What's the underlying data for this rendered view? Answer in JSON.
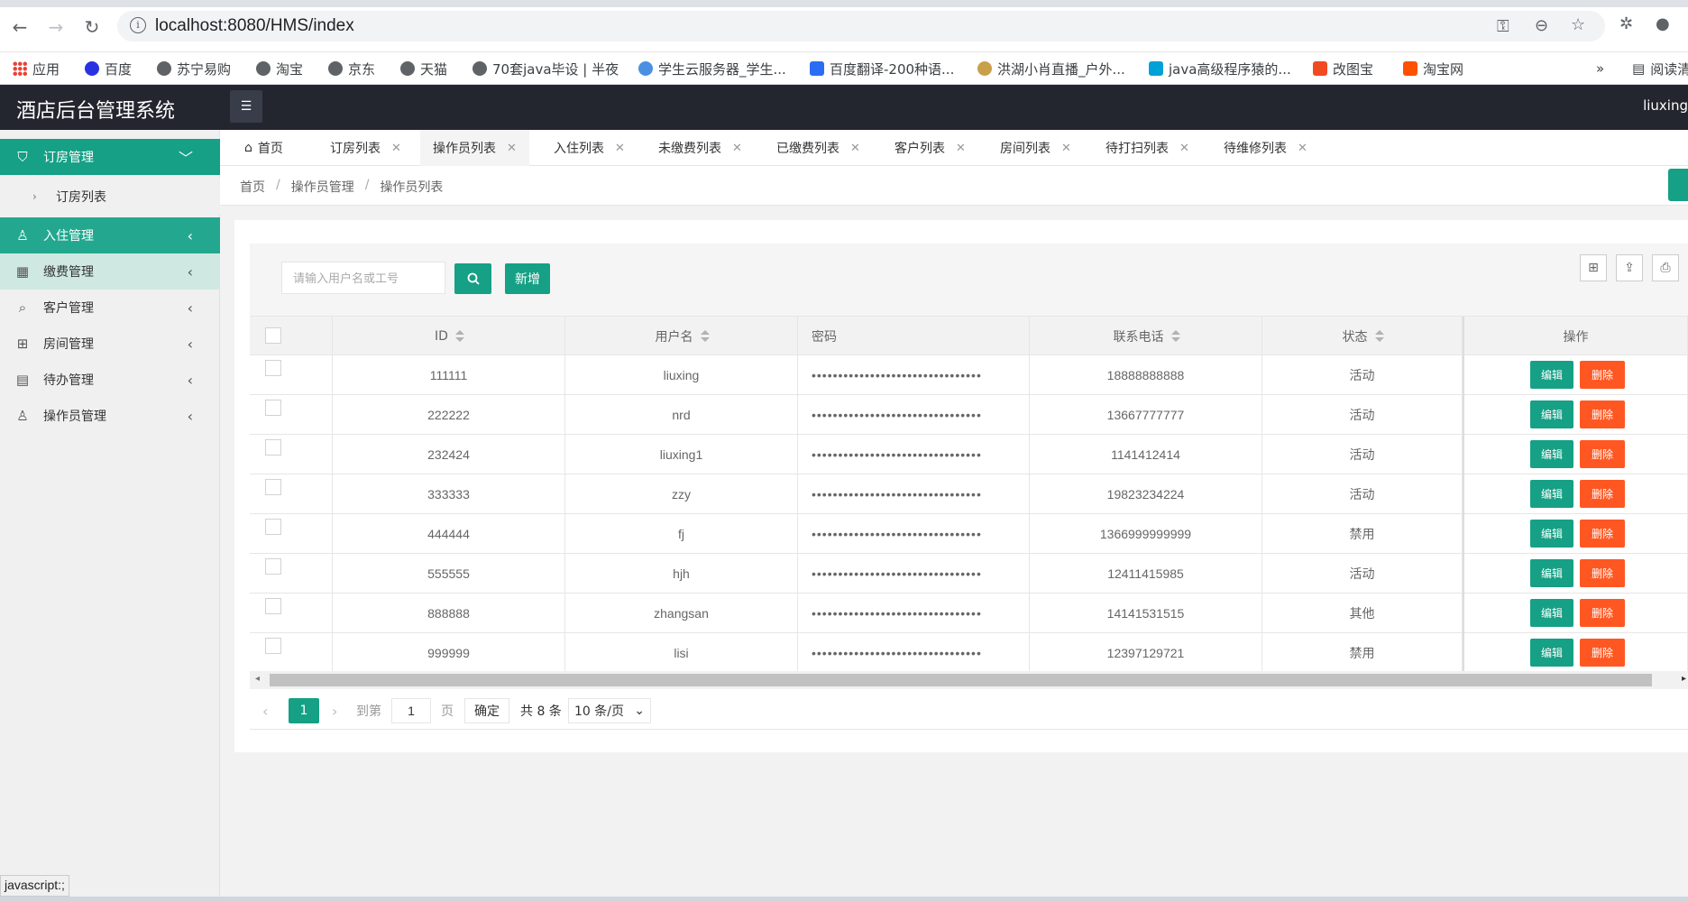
{
  "browser": {
    "url": "localhost:8080/HMS/index",
    "bookmarks": [
      "应用",
      "百度",
      "苏宁易购",
      "淘宝",
      "京东",
      "天猫",
      "70套java毕设 | 半夜",
      "学生云服务器_学生...",
      "百度翻译-200种语...",
      "洪湖小肖直播_户外...",
      "java高级程序猿的...",
      "改图宝",
      "淘宝网"
    ],
    "more_bookmarks": "»",
    "reading_list": "阅读清单"
  },
  "app": {
    "title": "酒店后台管理系统",
    "user": "liuxing"
  },
  "sidebar": {
    "items": [
      {
        "label": "订房管理",
        "icon": "shield-check-icon"
      },
      {
        "label": "入住管理",
        "icon": "user-icon"
      },
      {
        "label": "缴费管理",
        "icon": "bill-icon"
      },
      {
        "label": "客户管理",
        "icon": "search-icon"
      },
      {
        "label": "房间管理",
        "icon": "grid-icon"
      },
      {
        "label": "待办管理",
        "icon": "todo-icon"
      },
      {
        "label": "操作员管理",
        "icon": "operator-icon"
      }
    ],
    "sub_item": "订房列表"
  },
  "tabs": [
    {
      "label": "首页"
    },
    {
      "label": "订房列表"
    },
    {
      "label": "操作员列表"
    },
    {
      "label": "入住列表"
    },
    {
      "label": "未缴费列表"
    },
    {
      "label": "已缴费列表"
    },
    {
      "label": "客户列表"
    },
    {
      "label": "房间列表"
    },
    {
      "label": "待打扫列表"
    },
    {
      "label": "待维修列表"
    }
  ],
  "breadcrumb": [
    "首页",
    "操作员管理",
    "操作员列表"
  ],
  "toolbar": {
    "search_placeholder": "请输入用户名或工号",
    "add_label": "新增"
  },
  "table": {
    "columns": [
      "ID",
      "用户名",
      "密码",
      "联系电话",
      "状态",
      "操作"
    ],
    "rows": [
      {
        "id": "111111",
        "username": "liuxing",
        "password": "••••••••••••••••••••••••••••••••",
        "phone": "18888888888",
        "status": "活动"
      },
      {
        "id": "222222",
        "username": "nrd",
        "password": "••••••••••••••••••••••••••••••••",
        "phone": "13667777777",
        "status": "活动"
      },
      {
        "id": "232424",
        "username": "liuxing1",
        "password": "••••••••••••••••••••••••••••••••",
        "phone": "1141412414",
        "status": "活动"
      },
      {
        "id": "333333",
        "username": "zzy",
        "password": "••••••••••••••••••••••••••••••••",
        "phone": "19823234224",
        "status": "活动"
      },
      {
        "id": "444444",
        "username": "fj",
        "password": "••••••••••••••••••••••••••••••••",
        "phone": "1366999999999",
        "status": "禁用"
      },
      {
        "id": "555555",
        "username": "hjh",
        "password": "••••••••••••••••••••••••••••••••",
        "phone": "12411415985",
        "status": "活动"
      },
      {
        "id": "888888",
        "username": "zhangsan",
        "password": "••••••••••••••••••••••••••••••••",
        "phone": "14141531515",
        "status": "其他"
      },
      {
        "id": "999999",
        "username": "lisi",
        "password": "••••••••••••••••••••••••••••••••",
        "phone": "12397129721",
        "status": "禁用"
      }
    ],
    "edit_label": "编辑",
    "delete_label": "删除"
  },
  "pagination": {
    "current": "1",
    "goto_label": "到第",
    "page_input": "1",
    "page_unit": "页",
    "confirm": "确定",
    "total": "共 8 条",
    "page_size": "10 条/页"
  },
  "status_bar": "javascript:;"
}
